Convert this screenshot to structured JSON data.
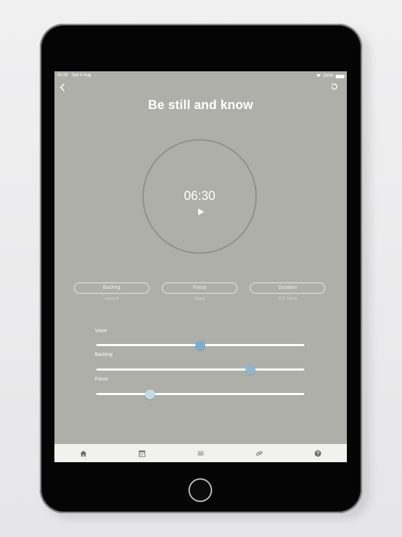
{
  "status_bar": {
    "time": "06:28",
    "date": "Sun 6 Aug",
    "battery": "100%"
  },
  "header": {
    "title": "Be still and know",
    "back_icon": "chevron-left-icon",
    "restart_icon": "restart-icon"
  },
  "timer": {
    "time": "06:30",
    "play_icon": "play-icon"
  },
  "options": [
    {
      "label": "Backing",
      "value": "vacant"
    },
    {
      "label": "Focus",
      "value": "bowl"
    },
    {
      "label": "Duration",
      "value": "6.5 mins"
    }
  ],
  "sliders": [
    {
      "label": "Voice",
      "value": 0.5,
      "color": "#79aed0"
    },
    {
      "label": "Backing",
      "value": 0.74,
      "color": "#8db8d2"
    },
    {
      "label": "Focus",
      "value": 0.26,
      "color": "#c3dbe6"
    }
  ],
  "tabbar": {
    "items": [
      {
        "icon": "home-icon"
      },
      {
        "icon": "calendar-icon"
      },
      {
        "icon": "menu-icon"
      },
      {
        "icon": "link-icon"
      },
      {
        "icon": "help-icon"
      }
    ]
  },
  "colors": {
    "screen_bg": "#aeafa8",
    "tabbar_bg": "#f1f1ee",
    "accent": "#79aed0"
  }
}
